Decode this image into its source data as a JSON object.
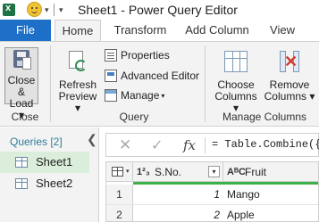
{
  "window": {
    "title": "Sheet1 - Power Query Editor",
    "quick_access_arrow": "▾"
  },
  "tabs": [
    "File",
    "Home",
    "Transform",
    "Add Column",
    "View"
  ],
  "ribbon": {
    "close": {
      "close_load_line1": "Close &",
      "close_load_line2": "Load ▾",
      "group_label": "Close"
    },
    "query": {
      "refresh_line1": "Refresh",
      "refresh_line2": "Preview ▾",
      "properties": "Properties",
      "advanced_editor": "Advanced Editor",
      "manage": "Manage",
      "group_label": "Query"
    },
    "manage_columns": {
      "choose_line1": "Choose",
      "choose_line2": "Columns ▾",
      "remove_line1": "Remove",
      "remove_line2": "Columns ▾",
      "group_label": "Manage Columns"
    }
  },
  "queries_pane": {
    "header": "Queries [2]",
    "collapse_glyph": "❮",
    "items": [
      {
        "label": "Sheet1",
        "selected": true
      },
      {
        "label": "Sheet2",
        "selected": false
      }
    ]
  },
  "formula_bar": {
    "cancel_glyph": "✕",
    "commit_glyph": "✓",
    "fx": "fx",
    "formula": "= Table.Combine({Sh"
  },
  "grid": {
    "columns": [
      {
        "type_badge": "1²₃",
        "name": "S.No."
      },
      {
        "type_badge": "AᴮC",
        "name": "Fruit"
      }
    ],
    "rows": [
      {
        "row_number": "1",
        "sno": "1",
        "fruit": "Mango"
      },
      {
        "row_number": "2",
        "sno": "2",
        "fruit": "Apple"
      }
    ]
  },
  "colors": {
    "file_tab": "#1e6fc7",
    "selected_query": "#dbeedb",
    "column_quality_bar": "#3bb14a"
  }
}
